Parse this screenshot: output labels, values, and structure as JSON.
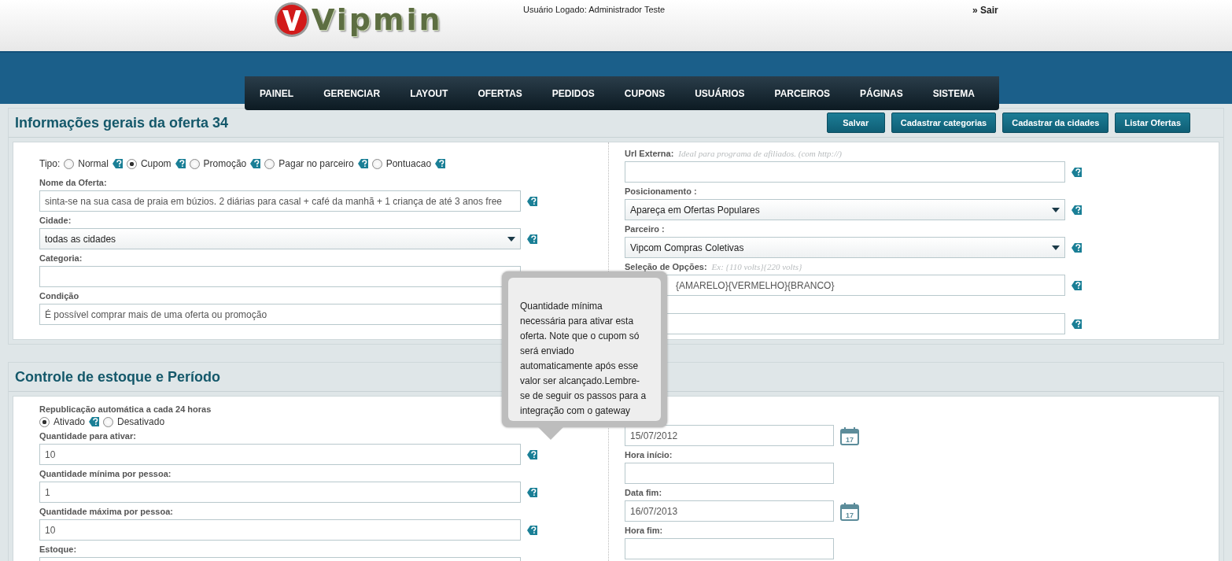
{
  "header": {
    "logo": "Vipmin",
    "user": "Usuário Logado: Administrador Teste",
    "logout_marker": "»",
    "logout": "Sair"
  },
  "nav": [
    {
      "label": "PAINEL"
    },
    {
      "label": "GERENCIAR"
    },
    {
      "label": "LAYOUT"
    },
    {
      "label": "OFERTAS"
    },
    {
      "label": "PEDIDOS"
    },
    {
      "label": "CUPONS"
    },
    {
      "label": "USUÁRIOS"
    },
    {
      "label": "PARCEIROS"
    },
    {
      "label": "PÁGINAS"
    },
    {
      "label": "SISTEMA"
    }
  ],
  "section1": {
    "title": "Informações gerais da oferta 34",
    "buttons": [
      "Salvar",
      "Cadastrar categorias",
      "Cadastrar da cidades",
      "Listar Ofertas"
    ],
    "tipo": {
      "label": "Tipo:",
      "options": [
        {
          "label": "Normal",
          "selected": false
        },
        {
          "label": "Cupom",
          "selected": true
        },
        {
          "label": "Promoção",
          "selected": false
        },
        {
          "label": "Pagar no parceiro",
          "selected": false
        },
        {
          "label": "Pontuacao",
          "selected": false
        }
      ]
    },
    "left": [
      {
        "kind": "text",
        "label": "Nome da Oferta:",
        "value": "sinta-se na sua casa de praia em búzios. 2 diárias para casal + café da manhã + 1 criança de até 3 anos free",
        "help": true
      },
      {
        "kind": "select",
        "label": "Cidade:",
        "value": "todas as cidades",
        "help": true
      },
      {
        "kind": "text",
        "label": "Categoria:",
        "help": false
      },
      {
        "kind": "text",
        "label": "Condição",
        "value": "É possível comprar mais de uma oferta ou promoção",
        "help": false
      }
    ],
    "right": [
      {
        "kind": "text",
        "label": "Url Externa:",
        "hint": "Ideal para programa de afiliados. (com http://)",
        "help": true
      },
      {
        "kind": "select",
        "label": "Posicionamento :",
        "value": "Apareça em Ofertas Populares",
        "help": true
      },
      {
        "kind": "select",
        "label": "Parceiro :",
        "value": "Vipcom Compras Coletivas",
        "help": true
      },
      {
        "kind": "text",
        "label": "Seleção de Opções:",
        "hint": "Ex: {110 volts}{220 volts}",
        "value": "{AMARELO}{VERMELHO}{BRANCO}",
        "covered": true,
        "help": true
      },
      {
        "kind": "text",
        "help": true
      }
    ]
  },
  "section2": {
    "title": "Controle de estoque e Período",
    "republicacao": {
      "label": "Republicação automática a cada 24 horas",
      "options": [
        {
          "label": "Ativado",
          "selected": true
        },
        {
          "label": "Desativado",
          "selected": false
        }
      ]
    },
    "left": [
      {
        "kind": "text",
        "label": "Quantidade para ativar:",
        "value": "10",
        "help": true
      },
      {
        "kind": "text",
        "label": "Quantidade mínima por pessoa:",
        "value": "1",
        "help": true
      },
      {
        "kind": "text",
        "label": "Quantidade máxima por pessoa:",
        "value": "10",
        "help": true
      },
      {
        "kind": "text",
        "label": "Estoque:",
        "help": false
      }
    ],
    "right": [
      {
        "kind": "date",
        "value": "15/07/2012",
        "calendar_day": "17"
      },
      {
        "kind": "text",
        "label": "Hora início:"
      },
      {
        "kind": "date",
        "label": "Data fim:",
        "value": "16/07/2013",
        "calendar_day": "17"
      },
      {
        "kind": "text",
        "label": "Hora fim:"
      }
    ]
  },
  "tooltip": {
    "text": "Quantidade mínima necessária para ativar esta oferta. Note que o cupom só será enviado automaticamente após esse valor ser alcançado.Lembre-se de seguir os passos para a integração com o gateway"
  }
}
